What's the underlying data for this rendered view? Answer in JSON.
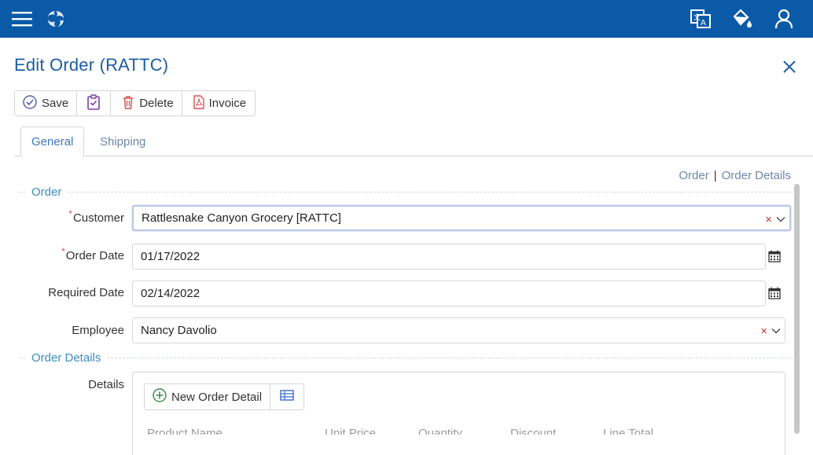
{
  "header": {
    "menu_icon": "hamburger-icon",
    "logo_icon": "swirl-logo-icon",
    "translate_icon": "translate-icon",
    "theme_icon": "paint-bucket-icon",
    "user_icon": "user-icon",
    "bar_color": "#0a5aa8"
  },
  "page": {
    "title": "Edit Order (RATTC)"
  },
  "toolbar": {
    "save_label": "Save",
    "delete_label": "Delete",
    "invoice_label": "Invoice"
  },
  "tabs": [
    {
      "label": "General",
      "active": true
    },
    {
      "label": "Shipping",
      "active": false
    }
  ],
  "breadcrumbs": {
    "order": "Order",
    "separator": "|",
    "order_details": "Order Details"
  },
  "sections": {
    "order": "Order",
    "order_details": "Order Details"
  },
  "form": {
    "customer": {
      "label": "Customer",
      "value": "Rattlesnake Canyon Grocery [RATTC]",
      "required": true
    },
    "order_date": {
      "label": "Order Date",
      "value": "01/17/2022",
      "required": true
    },
    "required_date": {
      "label": "Required Date",
      "value": "02/14/2022",
      "required": false
    },
    "employee": {
      "label": "Employee",
      "value": "Nancy Davolio",
      "required": false
    },
    "details": {
      "label": "Details"
    }
  },
  "details_toolbar": {
    "new_label": "New Order Detail"
  },
  "details_columns": [
    "Product Name",
    "Unit Price",
    "Quantity",
    "Discount",
    "Line Total"
  ],
  "accent_color": "#1c5ea3",
  "required_marker": "*",
  "clear_glyph": "×"
}
